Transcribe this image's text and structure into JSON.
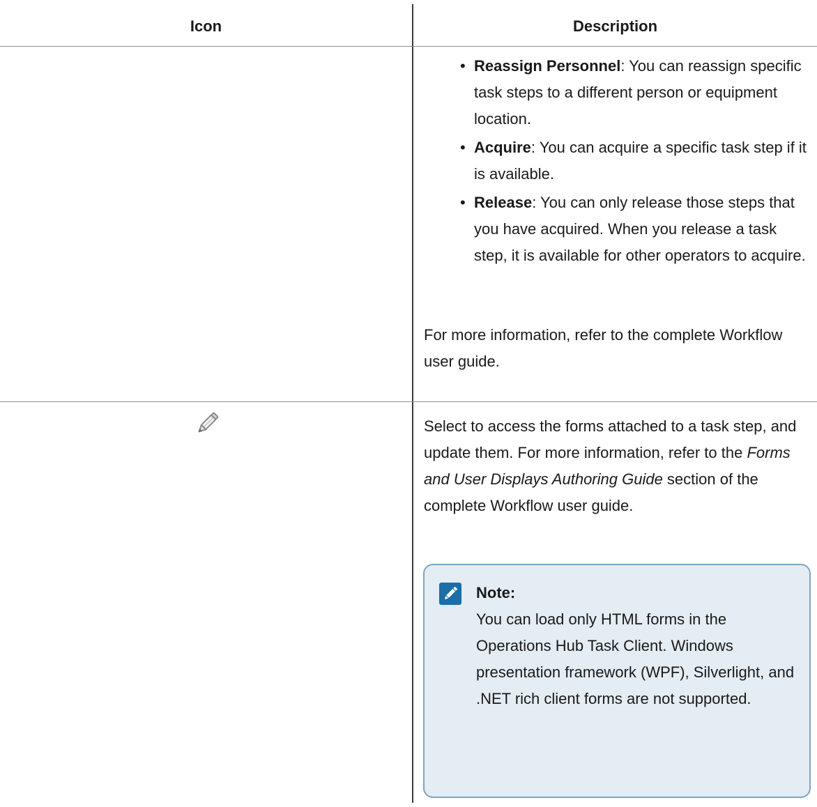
{
  "table": {
    "headers": {
      "icon": "Icon",
      "description": "Description"
    },
    "row1": {
      "bullets": [
        {
          "term": "Reassign Personnel",
          "text": ": You can reassign specific task steps to a different person or equipment location."
        },
        {
          "term": "Acquire",
          "text": ": You can acquire a specific task step if it is available."
        },
        {
          "term": "Release",
          "text": ": You can only release those steps that you have acquired. When you release a task step, it is available for other operators to acquire."
        }
      ],
      "more_info": "For more information, refer to the complete Workflow user guide."
    },
    "row2": {
      "icon": "pencil-icon",
      "desc_lead": "Select to access the forms attached to a task step, and update them. For more information, refer to the ",
      "desc_italic": "Forms and User Displays Authoring Guide",
      "desc_tail": " section of the complete Workflow user guide.",
      "note": {
        "icon": "pencil-note-icon",
        "title": "Note:",
        "body": "You can load only HTML forms in the Operations Hub Task Client. Windows presentation framework (WPF), Silverlight, and .NET rich client forms are not supported.",
        "accent_color": "#1b6ea8",
        "background_color": "#e4edf3",
        "border_color": "#7fa4bd"
      }
    }
  }
}
